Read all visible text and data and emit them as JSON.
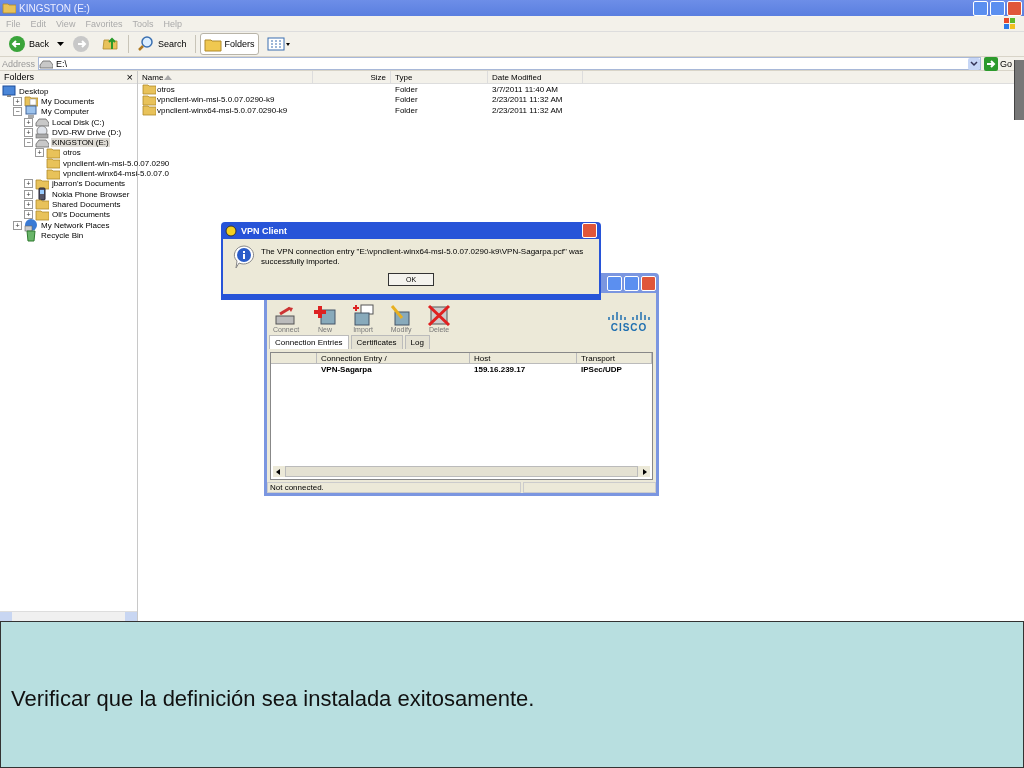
{
  "explorer": {
    "title": "KINGSTON (E:)",
    "menu": [
      "File",
      "Edit",
      "View",
      "Favorites",
      "Tools",
      "Help"
    ],
    "toolbar": [
      {
        "kind": "back",
        "label": "Back",
        "pressed": false
      },
      {
        "kind": "forward",
        "pressed": false
      },
      {
        "kind": "up",
        "pressed": false
      },
      {
        "kind": "search",
        "label": "Search",
        "pressed": false
      },
      {
        "kind": "folders",
        "label": "Folders",
        "pressed": true
      },
      {
        "kind": "views",
        "pressed": false
      }
    ],
    "address": {
      "label": "Address",
      "value": "E:\\",
      "go": "Go"
    },
    "folders_pane": {
      "title": "Folders",
      "close": "×",
      "tree": [
        {
          "label": "Desktop",
          "kind": "desktop",
          "selected": false,
          "children": [
            {
              "label": "My Documents",
              "kind": "docs",
              "toggle": "+",
              "selected": false
            },
            {
              "label": "My Computer",
              "kind": "computer",
              "toggle": "−",
              "selected": false,
              "children": [
                {
                  "label": "Local Disk (C:)",
                  "kind": "drive",
                  "toggle": "+",
                  "selected": false
                },
                {
                  "label": "DVD-RW Drive (D:)",
                  "kind": "cdrom",
                  "toggle": "+",
                  "selected": false
                },
                {
                  "label": "KINGSTON (E:)",
                  "kind": "drive",
                  "toggle": "−",
                  "selected": true,
                  "children": [
                    {
                      "label": "otros",
                      "kind": "folder",
                      "toggle": "+",
                      "selected": false
                    },
                    {
                      "label": "vpnclient-win-msi-5.0.07.0290",
                      "kind": "folder",
                      "selected": false
                    },
                    {
                      "label": "vpnclient-winx64-msi-5.0.07.0",
                      "kind": "folder",
                      "selected": false
                    }
                  ]
                },
                {
                  "label": "jbarron's Documents",
                  "kind": "folder",
                  "toggle": "+",
                  "selected": false
                },
                {
                  "label": "Nokia Phone Browser",
                  "kind": "phone",
                  "toggle": "+",
                  "selected": false
                },
                {
                  "label": "Shared Documents",
                  "kind": "folder",
                  "toggle": "+",
                  "selected": false
                },
                {
                  "label": "Oli's Documents",
                  "kind": "folder",
                  "toggle": "+",
                  "selected": false
                }
              ]
            },
            {
              "label": "My Network Places",
              "kind": "network",
              "toggle": "+",
              "selected": false
            },
            {
              "label": "Recycle Bin",
              "kind": "recycle",
              "selected": false
            }
          ]
        }
      ]
    },
    "files": {
      "columns": [
        {
          "label": "Name",
          "sorted": true
        },
        {
          "label": "Size",
          "sorted": false
        },
        {
          "label": "Type",
          "sorted": false
        },
        {
          "label": "Date Modified",
          "sorted": false
        }
      ],
      "rows": [
        {
          "name": "otros",
          "type": "Folder",
          "modified": "3/7/2011 11:40 AM"
        },
        {
          "name": "vpnclient-win-msi-5.0.07.0290-k9",
          "type": "Folder",
          "modified": "2/23/2011 11:32 AM"
        },
        {
          "name": "vpnclient-winx64-msi-5.0.07.0290-k9",
          "type": "Folder",
          "modified": "2/23/2011 11:32 AM"
        }
      ]
    }
  },
  "vpn_window": {
    "toolbar": [
      {
        "kind": "connect",
        "label": "Connect"
      },
      {
        "kind": "new",
        "label": "New"
      },
      {
        "kind": "import",
        "label": "Import"
      },
      {
        "kind": "modify",
        "label": "Modify"
      },
      {
        "kind": "delete",
        "label": "Delete"
      }
    ],
    "logo_text": "CISCO",
    "tabs": [
      {
        "label": "Connection Entries",
        "selected": true
      },
      {
        "label": "Certificates",
        "selected": false
      },
      {
        "label": "Log",
        "selected": false
      }
    ],
    "columns": [
      "",
      "Connection Entry  /",
      "Host",
      "Transport"
    ],
    "rows": [
      {
        "cells": [
          "",
          "VPN-Sagarpa",
          "159.16.239.17",
          "IPSec/UDP"
        ]
      }
    ],
    "status": "Not connected."
  },
  "dialog": {
    "title": "VPN Client",
    "message": "The VPN connection entry \"E:\\vpnclient-winx64-msi-5.0.07.0290-k9\\VPN-Sagarpa.pcf\" was successfully imported.",
    "button": "OK"
  },
  "caption": "Verificar que la definición sea instalada exitosamente."
}
